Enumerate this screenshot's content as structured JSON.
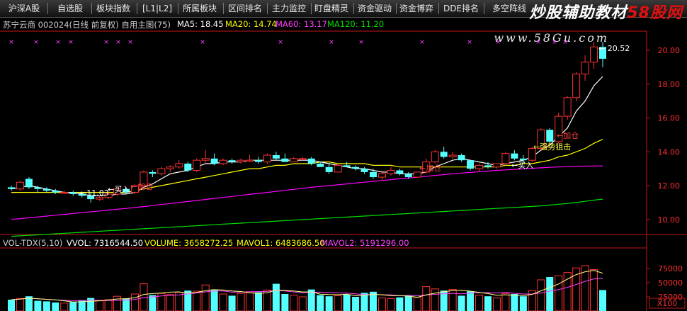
{
  "tabs": [
    "沪深A股",
    "自选股",
    "板块指数",
    "[L1|L2]",
    "所属板块",
    "区间排名",
    "主力监控",
    "盯盘精灵",
    "资金驱动",
    "资金博弈",
    "DDE排名",
    "多空阵线"
  ],
  "watermark": {
    "left": "炒股辅助教材",
    "right": "58股网"
  },
  "url": "www.58Gu.com",
  "price_header": {
    "title": "苏宁云商 002024(日线 前复权) 自用主图(75)",
    "ma5": "MA5: 18.45",
    "ma20": "MA20: 14.74",
    "ma60": "MA60: 13.17",
    "ma120": "MA120: 11.20"
  },
  "vol_header": {
    "title": "VOL-TDX(5,10)",
    "vvol": "VVOL: 7316544.50",
    "volume": "VOLUME: 3658272.25",
    "mavol1": "MAVOL1: 6483686.50",
    "mavol2": "MAVOL2: 5191296.00"
  },
  "annotations": {
    "high": "20.52",
    "low": "11.03",
    "buy1": "买入",
    "add1": "加仓",
    "add2": "加仓",
    "buy2": "买入",
    "add3": "加仓",
    "strong": "强势狙击"
  },
  "colors": {
    "up": "#ff3232",
    "down": "#54ffff",
    "ma5": "#ffffff",
    "ma20": "#ffff00",
    "ma60": "#ff00ff",
    "ma120": "#00e000"
  },
  "chart_data": {
    "type": "candlestick",
    "y_ticks": [
      "20.00",
      "18.00",
      "16.00",
      "14.00",
      "12.00",
      "10.00"
    ],
    "vol_ticks": [
      "75000",
      "50000",
      "25000"
    ],
    "vol_unit": "X100",
    "candles": [
      [
        11.9,
        12.0,
        11.7,
        11.8,
        20000
      ],
      [
        11.8,
        12.3,
        11.7,
        12.2,
        22000
      ],
      [
        12.4,
        12.5,
        11.8,
        11.9,
        26000
      ],
      [
        11.9,
        12.0,
        11.6,
        11.8,
        18000
      ],
      [
        11.8,
        11.9,
        11.6,
        11.7,
        17000
      ],
      [
        11.7,
        11.8,
        11.5,
        11.6,
        15000
      ],
      [
        11.6,
        11.7,
        11.5,
        11.6,
        14000
      ],
      [
        11.6,
        11.7,
        11.4,
        11.5,
        16000
      ],
      [
        11.5,
        11.6,
        11.3,
        11.4,
        19000
      ],
      [
        11.4,
        11.6,
        11.0,
        11.2,
        23000
      ],
      [
        11.2,
        11.4,
        11.1,
        11.3,
        18000
      ],
      [
        11.3,
        11.6,
        11.2,
        11.5,
        20000
      ],
      [
        11.5,
        11.9,
        11.4,
        11.8,
        26000
      ],
      [
        11.8,
        11.9,
        11.5,
        11.6,
        22000
      ],
      [
        11.6,
        12.1,
        11.5,
        12.0,
        30000
      ],
      [
        12.0,
        12.9,
        11.9,
        12.8,
        48000
      ],
      [
        12.8,
        12.9,
        12.5,
        12.7,
        28000
      ],
      [
        12.7,
        13.1,
        12.6,
        13.0,
        31000
      ],
      [
        13.0,
        13.2,
        12.8,
        13.1,
        29000
      ],
      [
        13.1,
        13.5,
        13.0,
        13.3,
        33000
      ],
      [
        13.3,
        13.4,
        12.8,
        12.9,
        36000
      ],
      [
        12.9,
        13.6,
        12.8,
        13.5,
        35000
      ],
      [
        13.5,
        14.1,
        13.3,
        13.6,
        46000
      ],
      [
        13.6,
        13.9,
        13.2,
        13.3,
        38000
      ],
      [
        13.3,
        13.6,
        13.2,
        13.5,
        30000
      ],
      [
        13.5,
        13.6,
        13.3,
        13.4,
        27000
      ],
      [
        13.4,
        13.6,
        13.3,
        13.5,
        31000
      ],
      [
        13.5,
        13.8,
        13.4,
        13.5,
        34000
      ],
      [
        13.5,
        13.7,
        13.3,
        13.4,
        33000
      ],
      [
        13.4,
        13.9,
        13.3,
        13.8,
        37000
      ],
      [
        13.8,
        14.0,
        13.5,
        13.6,
        48000
      ],
      [
        13.6,
        13.9,
        13.4,
        13.4,
        30000
      ],
      [
        13.4,
        13.7,
        13.4,
        13.6,
        28000
      ],
      [
        13.6,
        13.7,
        13.5,
        13.6,
        25000
      ],
      [
        13.6,
        13.7,
        13.2,
        13.3,
        38000
      ],
      [
        13.3,
        13.4,
        13.1,
        13.1,
        28000
      ],
      [
        13.1,
        13.3,
        12.7,
        12.8,
        26000
      ],
      [
        12.8,
        13.3,
        12.8,
        13.2,
        27000
      ],
      [
        13.2,
        13.4,
        13.1,
        13.1,
        29000
      ],
      [
        13.1,
        13.2,
        12.9,
        13.0,
        25000
      ],
      [
        13.0,
        13.1,
        12.7,
        12.8,
        32000
      ],
      [
        12.8,
        13.0,
        12.4,
        12.5,
        34000
      ],
      [
        12.5,
        12.8,
        12.3,
        12.7,
        23000
      ],
      [
        12.7,
        13.1,
        12.6,
        12.9,
        22000
      ],
      [
        12.9,
        13.0,
        12.6,
        12.7,
        24000
      ],
      [
        12.7,
        12.8,
        12.4,
        12.5,
        28000
      ],
      [
        12.5,
        12.8,
        12.5,
        12.8,
        24000
      ],
      [
        12.8,
        13.6,
        12.7,
        13.4,
        43000
      ],
      [
        13.4,
        14.1,
        13.3,
        14.0,
        39000
      ],
      [
        14.0,
        14.3,
        13.6,
        13.7,
        36000
      ],
      [
        13.7,
        14.0,
        13.6,
        13.8,
        38000
      ],
      [
        13.8,
        13.9,
        13.4,
        13.5,
        27000
      ],
      [
        13.5,
        13.5,
        12.9,
        13.0,
        35000
      ],
      [
        13.0,
        13.3,
        12.8,
        13.2,
        28000
      ],
      [
        13.2,
        13.4,
        13.0,
        13.1,
        26000
      ],
      [
        13.1,
        13.3,
        13.0,
        13.3,
        23000
      ],
      [
        13.3,
        14.0,
        13.2,
        13.9,
        31000
      ],
      [
        13.9,
        14.1,
        13.5,
        13.6,
        30000
      ],
      [
        13.6,
        13.8,
        13.3,
        13.5,
        26000
      ],
      [
        13.5,
        14.3,
        13.4,
        14.2,
        36000
      ],
      [
        14.2,
        15.4,
        14.1,
        15.3,
        55000
      ],
      [
        15.3,
        15.4,
        14.4,
        14.6,
        60000
      ],
      [
        14.6,
        16.3,
        14.5,
        16.1,
        62000
      ],
      [
        16.1,
        17.3,
        15.9,
        17.2,
        68000
      ],
      [
        17.2,
        18.7,
        17.0,
        18.6,
        76000
      ],
      [
        18.6,
        19.7,
        18.2,
        19.3,
        80000
      ],
      [
        19.3,
        20.5,
        18.9,
        20.2,
        73000
      ],
      [
        20.2,
        20.5,
        19.0,
        19.5,
        37000
      ]
    ],
    "ma5": [
      11.8,
      11.9,
      12.0,
      11.9,
      11.8,
      11.7,
      11.6,
      11.6,
      11.5,
      11.4,
      11.4,
      11.4,
      11.5,
      11.5,
      11.6,
      11.9,
      12.1,
      12.4,
      12.7,
      12.8,
      12.9,
      13.1,
      13.3,
      13.3,
      13.4,
      13.4,
      13.4,
      13.5,
      13.5,
      13.5,
      13.5,
      13.5,
      13.5,
      13.5,
      13.5,
      13.4,
      13.3,
      13.2,
      13.1,
      13.0,
      13.0,
      12.9,
      12.8,
      12.8,
      12.7,
      12.7,
      12.7,
      12.8,
      13.1,
      13.3,
      13.5,
      13.6,
      13.5,
      13.4,
      13.3,
      13.2,
      13.3,
      13.4,
      13.5,
      13.7,
      14.1,
      14.4,
      14.9,
      15.4,
      16.4,
      17.0,
      17.9,
      18.45
    ],
    "ma20": [
      11.6,
      11.6,
      11.6,
      11.6,
      11.6,
      11.6,
      11.6,
      11.6,
      11.6,
      11.6,
      11.6,
      11.6,
      11.6,
      11.6,
      11.7,
      11.8,
      11.9,
      12.0,
      12.1,
      12.2,
      12.3,
      12.4,
      12.5,
      12.6,
      12.7,
      12.8,
      12.9,
      13.0,
      13.0,
      13.1,
      13.2,
      13.2,
      13.3,
      13.3,
      13.3,
      13.4,
      13.4,
      13.3,
      13.3,
      13.3,
      13.3,
      13.2,
      13.2,
      13.2,
      13.1,
      13.1,
      13.1,
      13.1,
      13.1,
      13.1,
      13.1,
      13.1,
      13.1,
      13.1,
      13.1,
      13.1,
      13.2,
      13.2,
      13.3,
      13.3,
      13.4,
      13.5,
      13.7,
      13.8,
      14.0,
      14.2,
      14.5,
      14.74
    ],
    "ma60": [
      10.0,
      10.05,
      10.1,
      10.15,
      10.2,
      10.25,
      10.3,
      10.35,
      10.4,
      10.45,
      10.5,
      10.55,
      10.6,
      10.65,
      10.7,
      10.76,
      10.82,
      10.88,
      10.94,
      11.0,
      11.06,
      11.12,
      11.18,
      11.24,
      11.3,
      11.36,
      11.42,
      11.48,
      11.54,
      11.6,
      11.66,
      11.72,
      11.78,
      11.84,
      11.9,
      11.95,
      12.0,
      12.05,
      12.1,
      12.15,
      12.2,
      12.25,
      12.3,
      12.35,
      12.4,
      12.45,
      12.5,
      12.55,
      12.6,
      12.65,
      12.7,
      12.74,
      12.78,
      12.82,
      12.86,
      12.9,
      12.93,
      12.96,
      12.99,
      13.02,
      13.05,
      13.08,
      13.1,
      13.12,
      13.14,
      13.15,
      13.16,
      13.17
    ],
    "ma120": [
      9.0,
      9.03,
      9.06,
      9.09,
      9.12,
      9.15,
      9.18,
      9.21,
      9.24,
      9.27,
      9.3,
      9.33,
      9.36,
      9.39,
      9.42,
      9.45,
      9.48,
      9.51,
      9.54,
      9.57,
      9.6,
      9.63,
      9.66,
      9.69,
      9.72,
      9.75,
      9.78,
      9.81,
      9.84,
      9.87,
      9.9,
      9.93,
      9.96,
      9.99,
      10.02,
      10.05,
      10.08,
      10.11,
      10.14,
      10.17,
      10.2,
      10.23,
      10.26,
      10.29,
      10.32,
      10.35,
      10.38,
      10.41,
      10.44,
      10.47,
      10.5,
      10.53,
      10.56,
      10.59,
      10.62,
      10.65,
      10.68,
      10.71,
      10.74,
      10.77,
      10.8,
      10.85,
      10.9,
      10.95,
      11.0,
      11.07,
      11.14,
      11.2
    ]
  }
}
